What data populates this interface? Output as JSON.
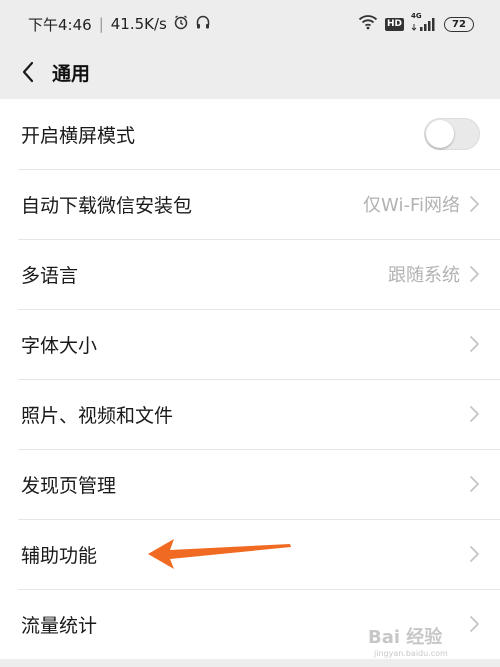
{
  "status_bar": {
    "time": "下午4:46",
    "speed": "41.5K/s",
    "hd": "HD",
    "network": "4G",
    "battery": "72"
  },
  "nav": {
    "title": "通用"
  },
  "settings": [
    {
      "label": "开启横屏模式",
      "type": "toggle",
      "enabled": false
    },
    {
      "label": "自动下载微信安装包",
      "value": "仅Wi-Fi网络",
      "type": "link"
    },
    {
      "label": "多语言",
      "value": "跟随系统",
      "type": "link"
    },
    {
      "label": "字体大小",
      "value": "",
      "type": "link"
    },
    {
      "label": "照片、视频和文件",
      "value": "",
      "type": "link"
    },
    {
      "label": "发现页管理",
      "value": "",
      "type": "link"
    },
    {
      "label": "辅助功能",
      "value": "",
      "type": "link"
    },
    {
      "label": "流量统计",
      "value": "",
      "type": "link"
    }
  ],
  "annotation": {
    "arrow_color": "#f06a22"
  },
  "watermark": {
    "text": "Bai 经验",
    "subtext": "jingyan.baidu.com"
  }
}
